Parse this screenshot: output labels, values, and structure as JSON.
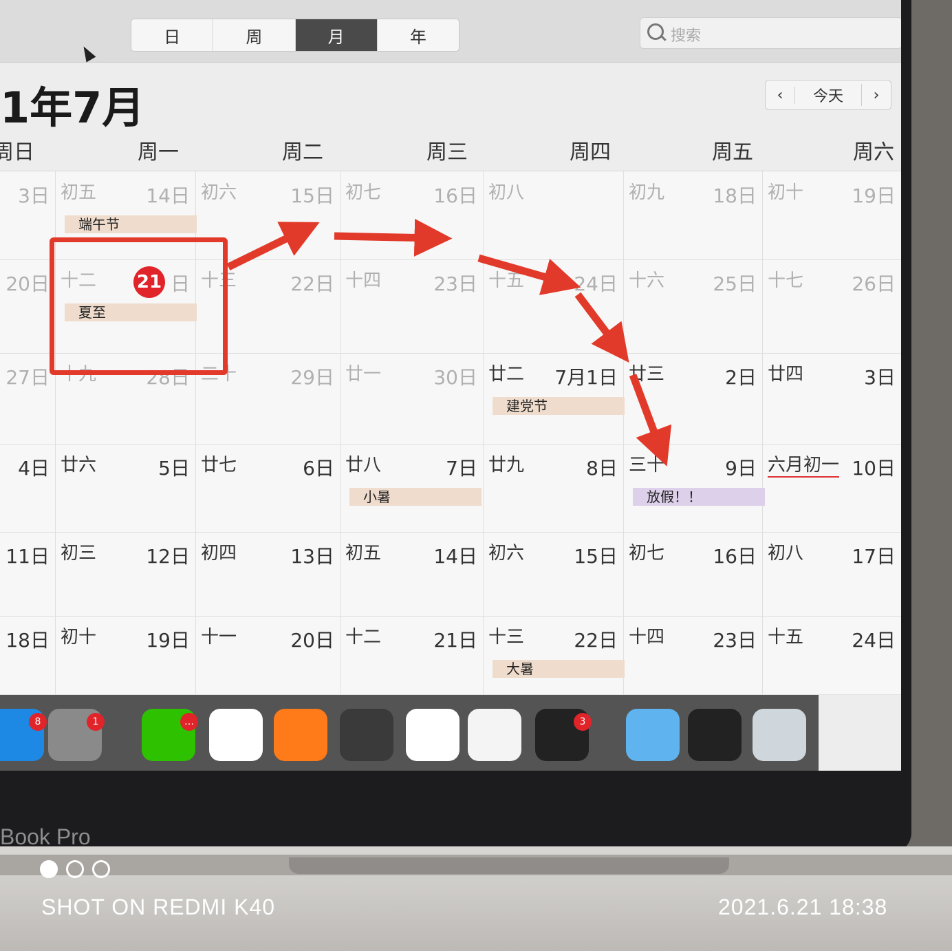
{
  "toolbar": {
    "views": [
      "日",
      "周",
      "月",
      "年"
    ],
    "active_view": "月",
    "search_placeholder": "搜索"
  },
  "calendar": {
    "title": "1年7月",
    "nav_prev": "‹",
    "nav_today": "今天",
    "nav_next": "›",
    "weekdays": [
      "周日",
      "周一",
      "周二",
      "周三",
      "周四",
      "周五",
      "周六"
    ]
  },
  "grid": {
    "rows": [
      [
        {
          "lunar": "",
          "day": "3日",
          "dim": true
        },
        {
          "lunar": "初五",
          "day": "14日",
          "dim": true,
          "event": "端午节"
        },
        {
          "lunar": "初六",
          "day": "15日",
          "dim": true
        },
        {
          "lunar": "初七",
          "day": "16日",
          "dim": true
        },
        {
          "lunar": "初八",
          "day": "",
          "dim": true
        },
        {
          "lunar": "初九",
          "day": "18日",
          "dim": true
        },
        {
          "lunar": "初十",
          "day": "19日",
          "dim": true
        }
      ],
      [
        {
          "lunar": "",
          "day": "20日",
          "dim": true
        },
        {
          "lunar": "十二",
          "day": "21",
          "dim": true,
          "today": true,
          "event": "夏至"
        },
        {
          "lunar": "十三",
          "day": "22日",
          "dim": true
        },
        {
          "lunar": "十四",
          "day": "23日",
          "dim": true
        },
        {
          "lunar": "十五",
          "day": "24日",
          "dim": true
        },
        {
          "lunar": "十六",
          "day": "25日",
          "dim": true
        },
        {
          "lunar": "十七",
          "day": "26日",
          "dim": true
        }
      ],
      [
        {
          "lunar": "",
          "day": "27日",
          "dim": true
        },
        {
          "lunar": "十九",
          "day": "28日",
          "dim": true
        },
        {
          "lunar": "二十",
          "day": "29日",
          "dim": true
        },
        {
          "lunar": "廿一",
          "day": "30日",
          "dim": true
        },
        {
          "lunar": "廿二",
          "day": "7月1日",
          "dim": false,
          "event": "建党节"
        },
        {
          "lunar": "廿三",
          "day": "2日",
          "dim": false
        },
        {
          "lunar": "廿四",
          "day": "3日",
          "dim": false
        }
      ],
      [
        {
          "lunar": "",
          "day": "4日",
          "dim": false
        },
        {
          "lunar": "廿六",
          "day": "5日",
          "dim": false
        },
        {
          "lunar": "廿七",
          "day": "6日",
          "dim": false
        },
        {
          "lunar": "廿八",
          "day": "7日",
          "dim": false,
          "event": "小暑"
        },
        {
          "lunar": "廿九",
          "day": "8日",
          "dim": false
        },
        {
          "lunar": "三十",
          "day": "9日",
          "dim": false,
          "event": "放假！！",
          "event_color": "purple"
        },
        {
          "lunar": "六月初一",
          "day": "10日",
          "dim": false,
          "lunar_marked": true
        }
      ],
      [
        {
          "lunar": "",
          "day": "11日",
          "dim": false
        },
        {
          "lunar": "初三",
          "day": "12日",
          "dim": false
        },
        {
          "lunar": "初四",
          "day": "13日",
          "dim": false
        },
        {
          "lunar": "初五",
          "day": "14日",
          "dim": false
        },
        {
          "lunar": "初六",
          "day": "15日",
          "dim": false
        },
        {
          "lunar": "初七",
          "day": "16日",
          "dim": false
        },
        {
          "lunar": "初八",
          "day": "17日",
          "dim": false
        }
      ],
      [
        {
          "lunar": "",
          "day": "18日",
          "dim": false
        },
        {
          "lunar": "初十",
          "day": "19日",
          "dim": false
        },
        {
          "lunar": "十一",
          "day": "20日",
          "dim": false
        },
        {
          "lunar": "十二",
          "day": "21日",
          "dim": false
        },
        {
          "lunar": "十三",
          "day": "22日",
          "dim": false,
          "event": "大暑"
        },
        {
          "lunar": "十四",
          "day": "23日",
          "dim": false
        },
        {
          "lunar": "十五",
          "day": "24日",
          "dim": false
        }
      ]
    ]
  },
  "dock": {
    "apps": [
      {
        "name": "app-store",
        "badge": "8",
        "color": "#1e88e5"
      },
      {
        "name": "system-preferences",
        "badge": "1",
        "color": "#8a8a8a"
      },
      {
        "name": "wechat",
        "badge": "…",
        "color": "#2dc100"
      },
      {
        "name": "chrome",
        "badge": "",
        "color": "#ffffff"
      },
      {
        "name": "firefox",
        "badge": "",
        "color": "#ff7a18"
      },
      {
        "name": "sublime-text",
        "badge": "",
        "color": "#3a3a3a"
      },
      {
        "name": "wps-office",
        "badge": "",
        "color": "#ffffff"
      },
      {
        "name": "typora",
        "badge": "",
        "color": "#f4f4f4"
      },
      {
        "name": "qq",
        "badge": "3",
        "color": "#222222"
      },
      {
        "name": "finder-folder",
        "badge": "",
        "color": "#5fb4ef"
      },
      {
        "name": "mission-control",
        "badge": "",
        "color": "#222222"
      },
      {
        "name": "trash",
        "badge": "",
        "color": "#cfd6dc"
      }
    ]
  },
  "device": {
    "label": "Book Pro"
  },
  "watermark": {
    "left": "SHOT ON REDMI K40",
    "right": "2021.6.21 18:38"
  },
  "annotation_color": "#e23a2a"
}
